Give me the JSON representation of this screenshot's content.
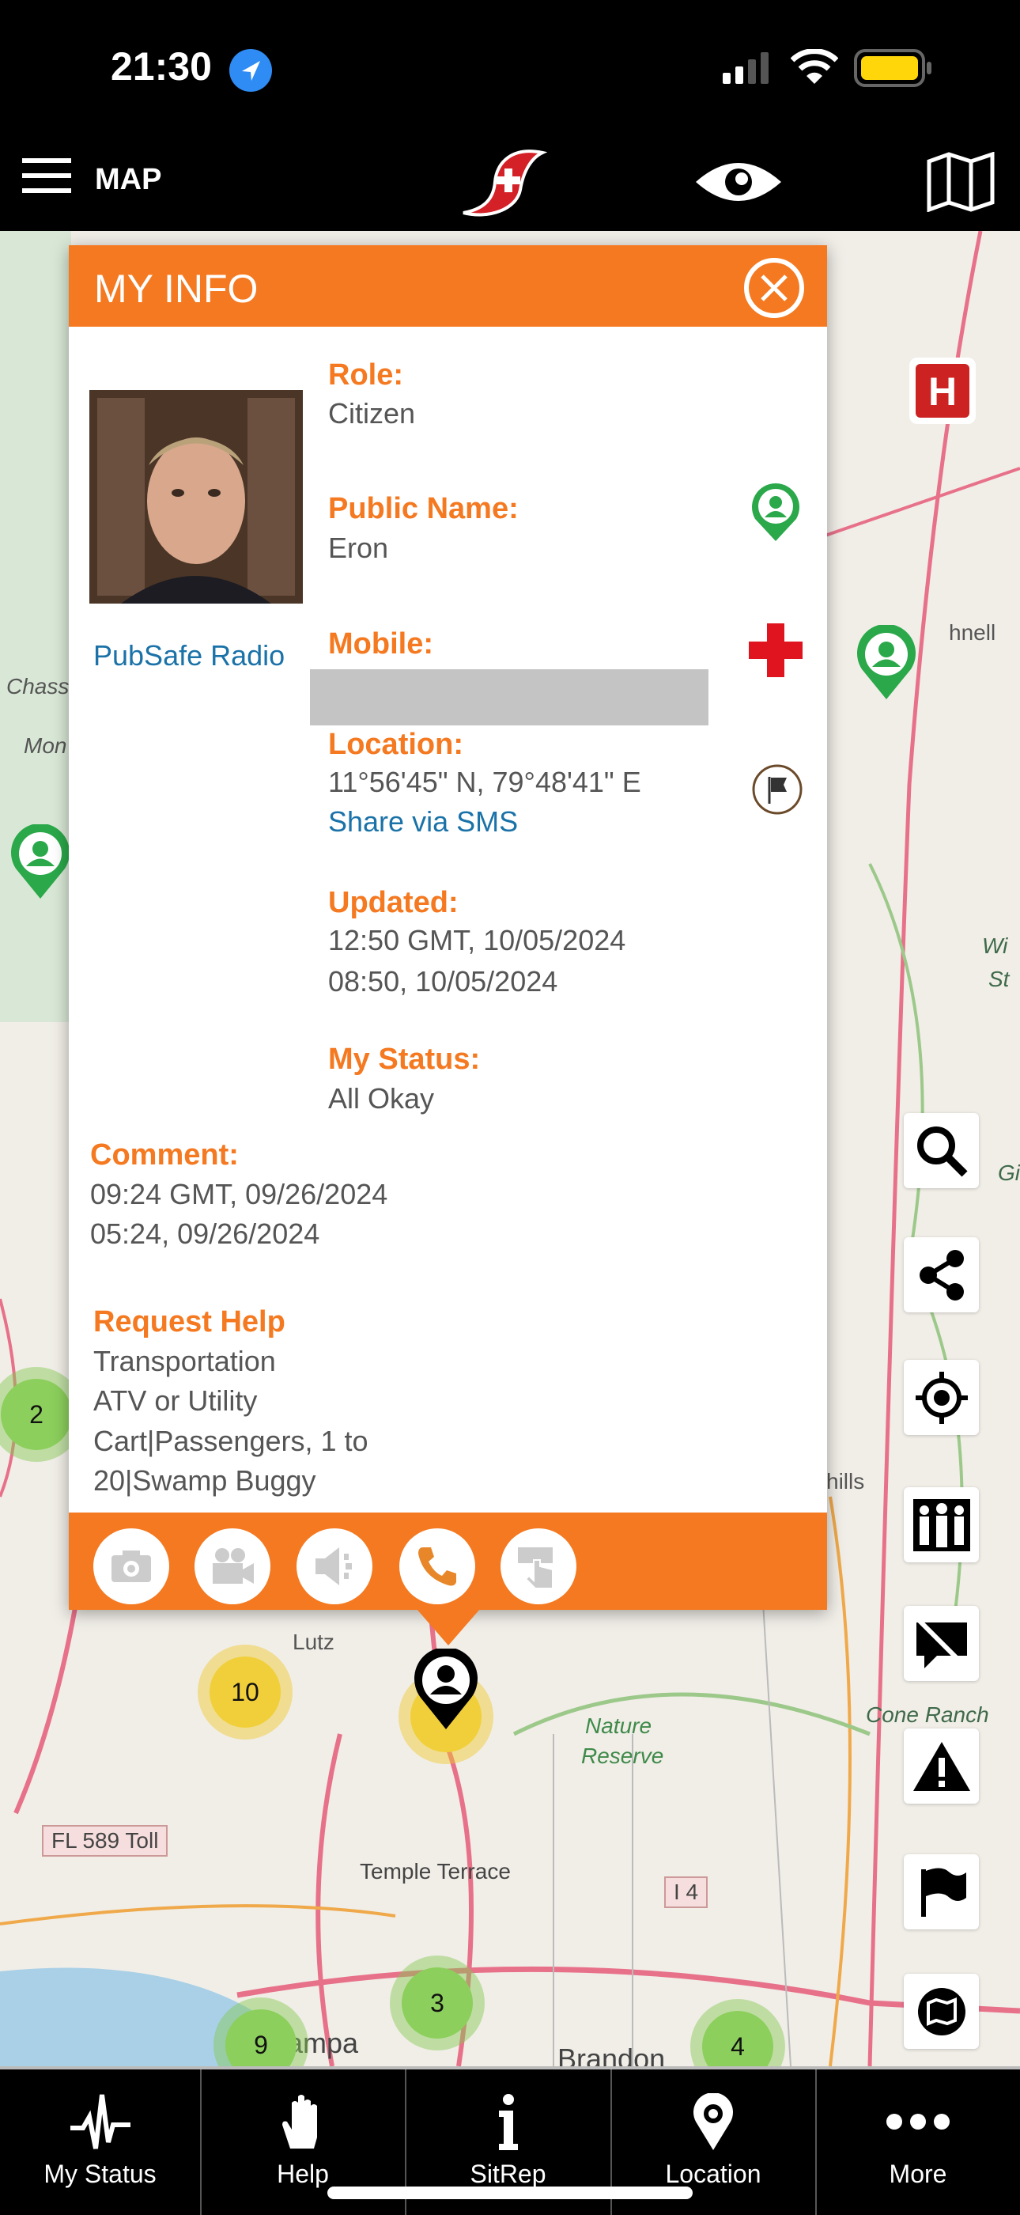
{
  "status_bar": {
    "time": "21:30",
    "battery_color": "#ffd60a"
  },
  "nav": {
    "title": "MAP",
    "icons": [
      "menu-icon",
      "app-logo",
      "eye-icon",
      "map-icon"
    ]
  },
  "map": {
    "labels": [
      "Lutz",
      "Nature",
      "Reserve",
      "FL 589 Toll",
      "Temple Terrace",
      "I 4",
      "Tampa",
      "Brandon",
      "Cone Ranch",
      "hnell",
      "Chass",
      "Wi",
      "St",
      "Mon",
      "Gi",
      "hills"
    ],
    "clusters": [
      "2",
      "10",
      "3",
      "9",
      "4"
    ],
    "side_buttons": [
      "search-icon",
      "share-icon",
      "locate-icon",
      "people-icon",
      "no-chat-icon",
      "warning-icon",
      "flag-icon",
      "map-icon"
    ]
  },
  "popup": {
    "title": "MY INFO",
    "radio_link": "PubSafe Radio",
    "role_label": "Role:",
    "role": "Citizen",
    "public_name_label": "Public Name:",
    "public_name": "Eron",
    "mobile_label": "Mobile:",
    "location_label": "Location:",
    "location": "11°56'45\" N, 79°48'41\" E",
    "share_sms": "Share via SMS",
    "updated_label": "Updated:",
    "updated_gmt": "12:50 GMT, 10/05/2024",
    "updated_local": "08:50, 10/05/2024",
    "status_label": "My Status:",
    "status": "All Okay",
    "comment_label": "Comment:",
    "comment_gmt": "09:24 GMT, 09/26/2024",
    "comment_local": "05:24, 09/26/2024",
    "request_label": "Request Help",
    "request_lines": [
      "Transportation",
      "ATV or Utility",
      "Cart|Passengers, 1 to",
      "20|Swamp Buggy"
    ],
    "actions": [
      "camera-icon",
      "video-icon",
      "speaker-icon",
      "phone-icon",
      "touch-icon"
    ],
    "accent": "#f47920"
  },
  "tabs": [
    {
      "label": "My Status"
    },
    {
      "label": "Help"
    },
    {
      "label": "SitRep"
    },
    {
      "label": "Location"
    },
    {
      "label": "More"
    }
  ]
}
